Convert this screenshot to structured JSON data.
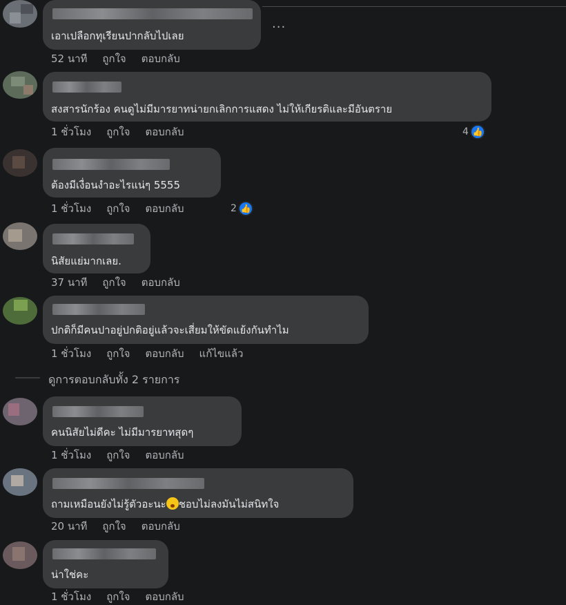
{
  "more_label": "...",
  "comments": [
    {
      "text": "เอาเปลือกทุเรียนปากลับไปเลย",
      "time": "52 นาที",
      "like": "ถูกใจ",
      "reply": "ตอบกลับ",
      "edited": "",
      "reactions": ""
    },
    {
      "text": "สงสารนักร้อง คนดูไม่มีมารยาทน่ายกเลิกการแสดง ไม่ให้เกียรติและมีอันตราย",
      "time": "1 ชั่วโมง",
      "like": "ถูกใจ",
      "reply": "ตอบกลับ",
      "edited": "",
      "reactions": "4"
    },
    {
      "text": "ต้องมีเงื่อนงำอะไรแน่ๆ 5555",
      "time": "1 ชั่วโมง",
      "like": "ถูกใจ",
      "reply": "ตอบกลับ",
      "edited": "",
      "reactions": "2"
    },
    {
      "text": "นิสัยแย่มากเลย.",
      "time": "37 นาที",
      "like": "ถูกใจ",
      "reply": "ตอบกลับ",
      "edited": "",
      "reactions": ""
    },
    {
      "text": "ปกติก็มีคนปาอยู่ปกติอยู่แล้วจะเสี่ยมให้ขัดแย้งกันทำไม",
      "time": "1 ชั่วโมง",
      "like": "ถูกใจ",
      "reply": "ตอบกลับ",
      "edited": "แก้ไขแล้ว",
      "reactions": ""
    },
    {
      "text": "คนนิสัยไม่ดีคะ ไม่มีมารยาทสุดๆ",
      "time": "1 ชั่วโมง",
      "like": "ถูกใจ",
      "reply": "ตอบกลับ",
      "edited": "",
      "reactions": ""
    },
    {
      "text_before": "ถามเหมือนยังไม่รู้ตัวอะนะ",
      "text_after": "ชอบไม่ลงมันไม่สนิทใจ",
      "time": "20 นาที",
      "like": "ถูกใจ",
      "reply": "ตอบกลับ",
      "edited": "",
      "reactions": ""
    },
    {
      "text": "น่าใช่คะ",
      "time": "1 ชั่วโมง",
      "like": "ถูกใจ",
      "reply": "ตอบกลับ",
      "edited": "",
      "reactions": ""
    }
  ],
  "view_replies": "ดูการตอบกลับทั้ง 2 รายการ",
  "colors": {
    "background": "#18191a",
    "bubble": "#3a3b3c",
    "text": "#e4e6eb",
    "meta": "#b0b3b8",
    "like_blue": "#1877f2"
  }
}
